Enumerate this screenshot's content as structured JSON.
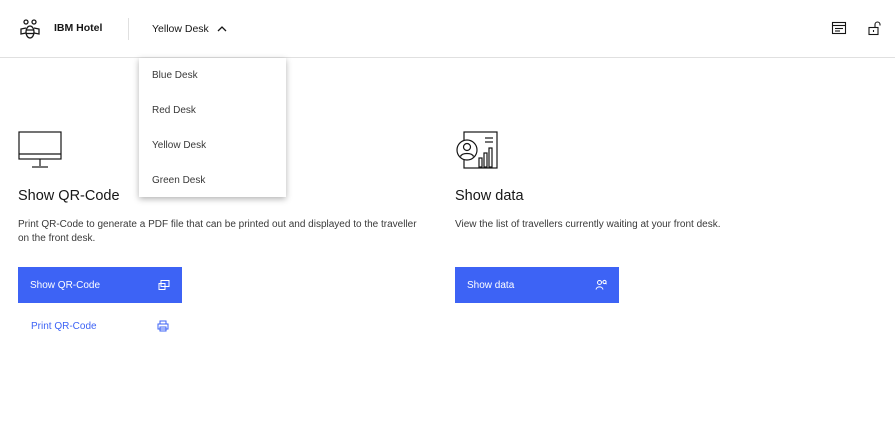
{
  "header": {
    "brand": "IBM Hotel",
    "logo_icon": "bee-icon",
    "selected_desk": "Yellow Desk",
    "chevron_icon": "chevron-up-icon",
    "right_icons": [
      "receipt-icon",
      "unlock-icon"
    ]
  },
  "dropdown": {
    "options": [
      {
        "label": "Blue Desk"
      },
      {
        "label": "Red Desk"
      },
      {
        "label": "Yellow Desk"
      },
      {
        "label": "Green Desk"
      }
    ]
  },
  "qr_card": {
    "icon": "monitor-icon",
    "title": "Show QR-Code",
    "description": "Print QR-Code to generate a PDF file that can be printed out and displayed to the traveller on the front desk.",
    "primary_button": {
      "label": "Show QR-Code",
      "icon": "screen-share-icon"
    },
    "secondary_button": {
      "label": "Print QR-Code",
      "icon": "printer-icon"
    }
  },
  "data_card": {
    "icon": "user-report-icon",
    "title": "Show data",
    "description": "View the list of travellers currently waiting at your front desk.",
    "primary_button": {
      "label": "Show data",
      "icon": "user-search-icon"
    }
  },
  "colors": {
    "accent": "#3d63f5",
    "divider": "#e0e0e0",
    "text": "#161616"
  }
}
